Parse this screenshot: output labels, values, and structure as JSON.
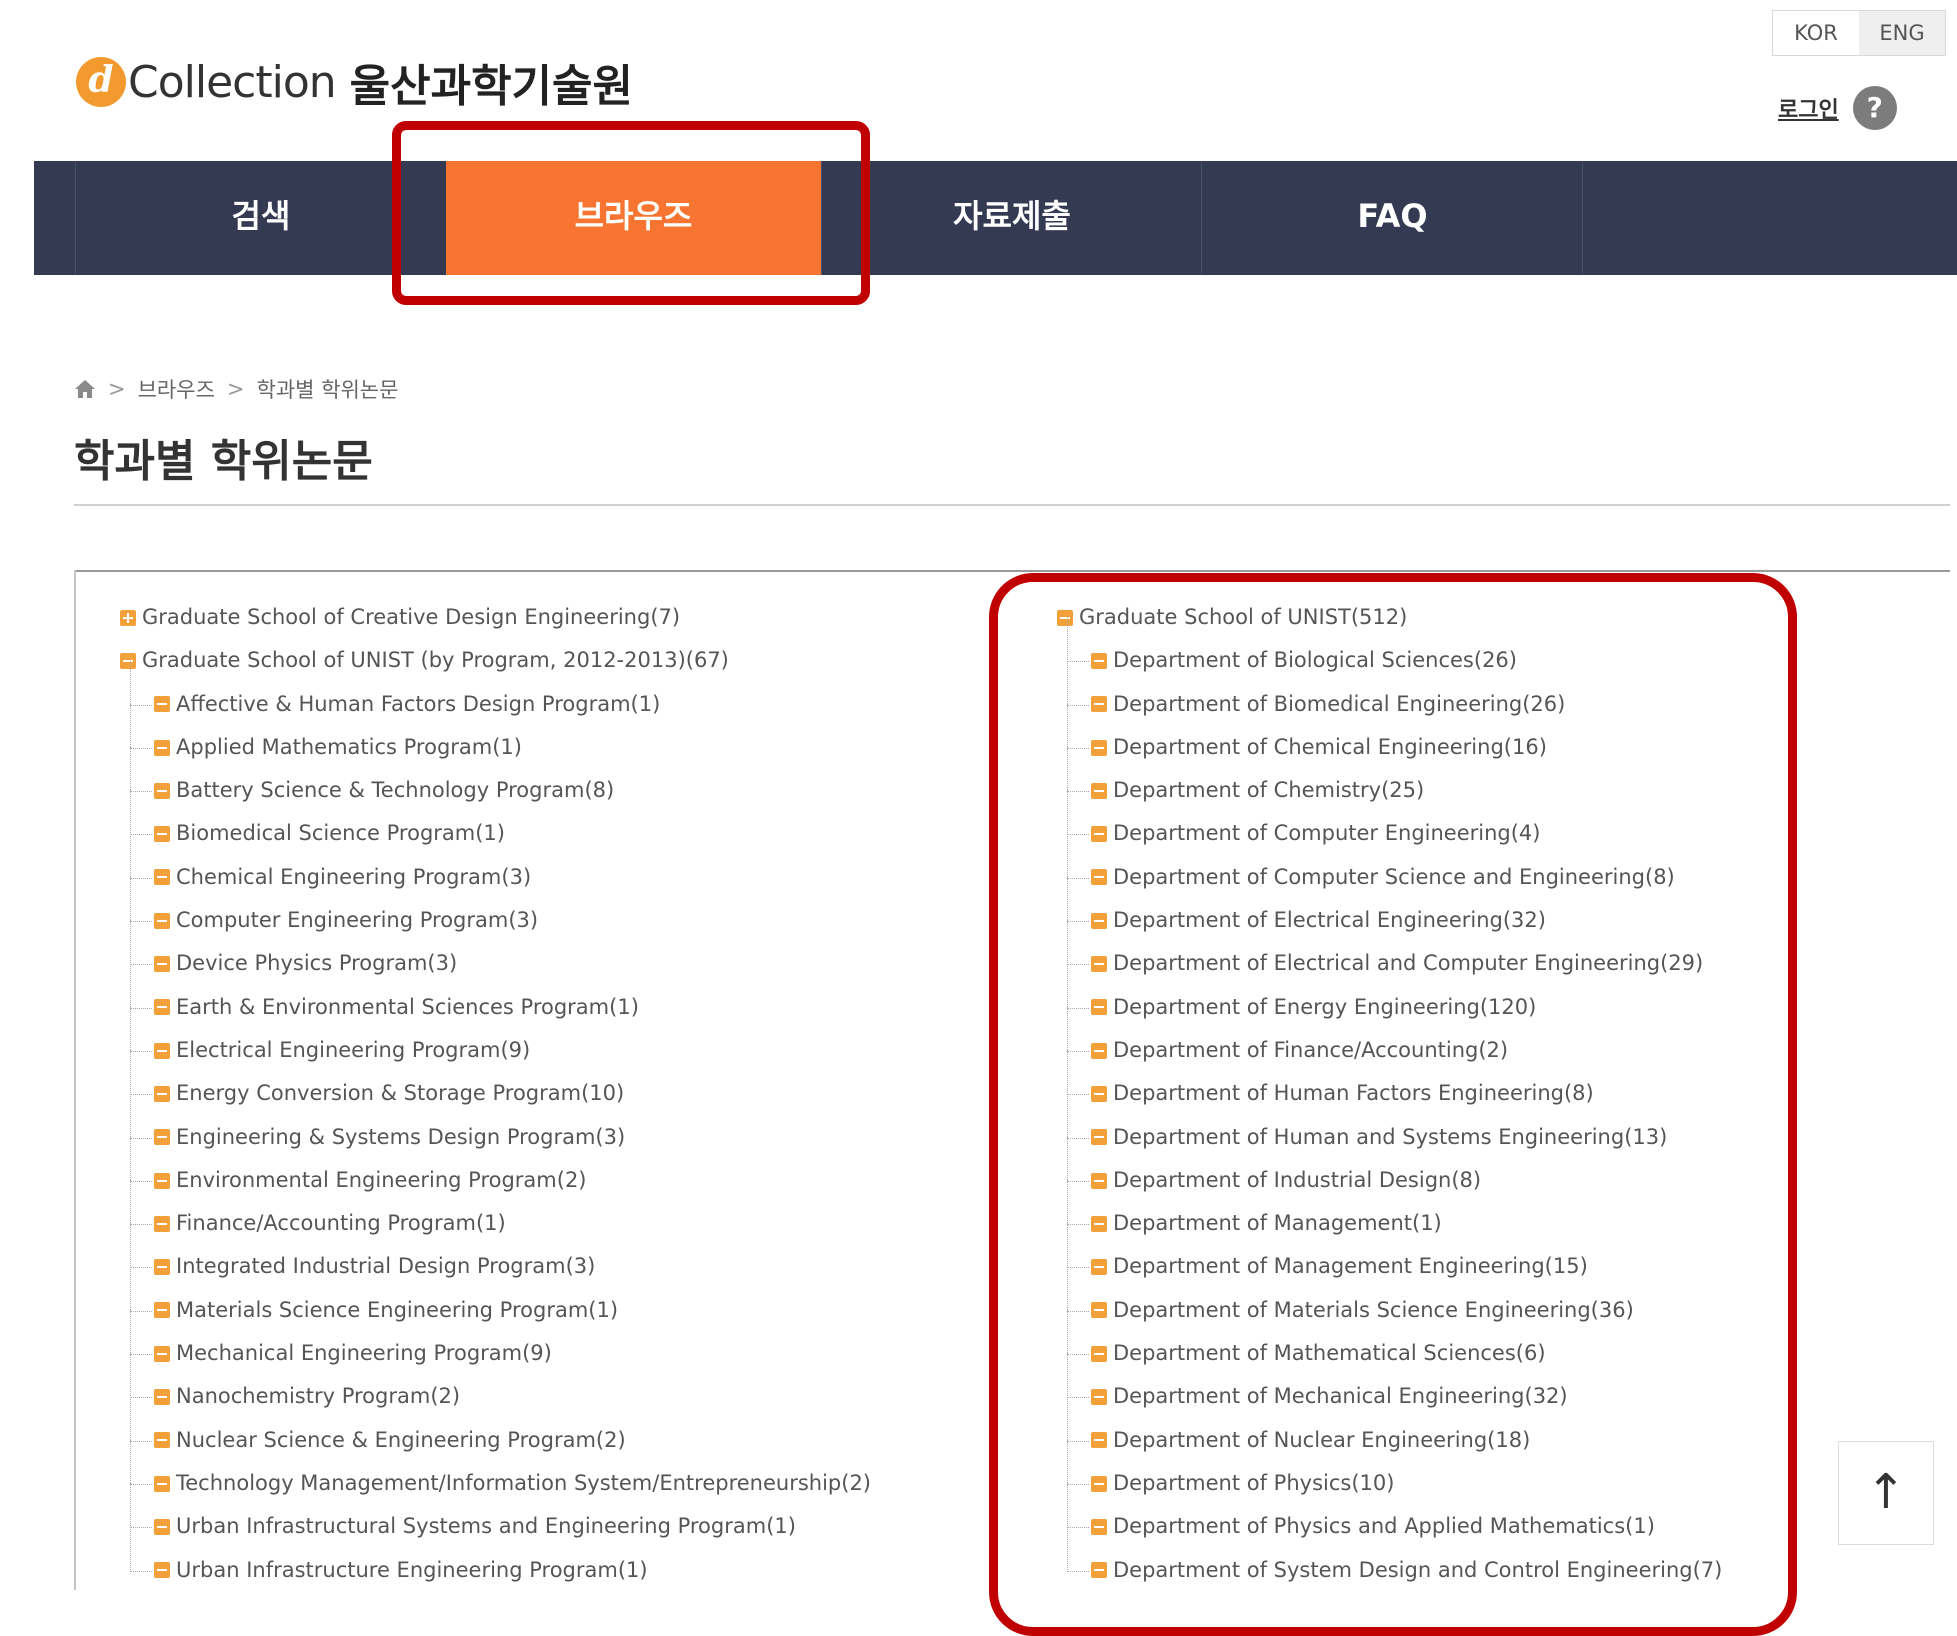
{
  "lang": {
    "kor": "KOR",
    "eng": "ENG"
  },
  "logo": {
    "mark": "d",
    "collection": "Collection",
    "name": "울산과학기술원"
  },
  "login": "로그인",
  "nav": [
    {
      "label": "검색"
    },
    {
      "label": "브라우즈"
    },
    {
      "label": "자료제출"
    },
    {
      "label": "FAQ"
    }
  ],
  "breadcrumb": {
    "items": [
      "브라우즈",
      "학과별 학위논문"
    ]
  },
  "page_title": "학과별 학위논문",
  "left_tree": {
    "collapsed_root": "Graduate School of Creative Design Engineering(7)",
    "root": "Graduate School of UNIST (by Program, 2012-2013)(67)",
    "children": [
      "Affective & Human Factors Design Program(1)",
      "Applied Mathematics Program(1)",
      "Battery Science & Technology Program(8)",
      "Biomedical Science Program(1)",
      "Chemical Engineering Program(3)",
      "Computer Engineering Program(3)",
      "Device Physics Program(3)",
      "Earth & Environmental Sciences Program(1)",
      "Electrical Engineering Program(9)",
      "Energy Conversion & Storage Program(10)",
      "Engineering & Systems Design Program(3)",
      "Environmental Engineering Program(2)",
      "Finance/Accounting Program(1)",
      "Integrated Industrial Design Program(3)",
      "Materials Science Engineering Program(1)",
      "Mechanical Engineering Program(9)",
      "Nanochemistry Program(2)",
      "Nuclear Science & Engineering Program(2)",
      "Technology Management/Information System/Entrepreneurship(2)",
      "Urban Infrastructural Systems and Engineering Program(1)",
      "Urban Infrastructure Engineering Program(1)"
    ]
  },
  "right_tree": {
    "root": "Graduate School of UNIST(512)",
    "children": [
      "Department of Biological Sciences(26)",
      "Department of Biomedical Engineering(26)",
      "Department of Chemical Engineering(16)",
      "Department of Chemistry(25)",
      "Department of Computer Engineering(4)",
      "Department of Computer Science and Engineering(8)",
      "Department of Electrical Engineering(32)",
      "Department of Electrical and Computer Engineering(29)",
      "Department of Energy Engineering(120)",
      "Department of Finance/Accounting(2)",
      "Department of Human Factors Engineering(8)",
      "Department of Human and Systems Engineering(13)",
      "Department of Industrial Design(8)",
      "Department of Management(1)",
      "Department of Management Engineering(15)",
      "Department of Materials Science Engineering(36)",
      "Department of Mathematical Sciences(6)",
      "Department of Mechanical Engineering(32)",
      "Department of Nuclear Engineering(18)",
      "Department of Physics(10)",
      "Department of Physics and Applied Mathematics(1)",
      "Department of System Design and Control Engineering(7)"
    ]
  },
  "colors": {
    "nav_bg": "#333a52",
    "nav_active": "#f77530",
    "highlight": "#c00000",
    "tree_icon": "#f2a13a"
  }
}
